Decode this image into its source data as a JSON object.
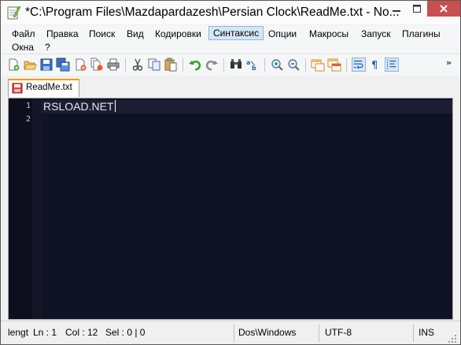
{
  "window": {
    "title": "*C:\\Program Files\\Mazdapardazesh\\Persian Clock\\ReadMe.txt - No..."
  },
  "menu": {
    "items": [
      {
        "label": "Файл"
      },
      {
        "label": "Правка"
      },
      {
        "label": "Поиск"
      },
      {
        "label": "Вид"
      },
      {
        "label": "Кодировки"
      },
      {
        "label": "Синтаксис",
        "active": true
      },
      {
        "label": "Опции"
      },
      {
        "label": "Макросы"
      },
      {
        "label": "Запуск"
      },
      {
        "label": "Плагины"
      },
      {
        "label": "Окна"
      },
      {
        "label": "?"
      }
    ]
  },
  "toolbar": {
    "icons": [
      "new-file-icon",
      "open-file-icon",
      "save-icon",
      "save-all-icon",
      "close-icon",
      "close-all-icon",
      "print-icon",
      "cut-icon",
      "copy-icon",
      "paste-icon",
      "undo-icon",
      "redo-icon",
      "find-icon",
      "replace-icon",
      "zoom-in-icon",
      "zoom-out-icon",
      "sync-vertical-icon",
      "sync-horizontal-icon",
      "word-wrap-icon",
      "show-all-chars-icon",
      "indent-guide-icon"
    ],
    "more_label": "»"
  },
  "tabs": [
    {
      "label": "ReadMe.txt",
      "unsaved": true
    }
  ],
  "editor": {
    "lines": [
      {
        "number": "1",
        "text": "RSLOAD.NET"
      },
      {
        "number": "2",
        "text": ""
      }
    ],
    "colors": {
      "background": "#101225",
      "text": "#e8e8e8"
    }
  },
  "status": {
    "length": "lengt",
    "ln": "Ln : 1",
    "col": "Col : 12",
    "sel": "Sel : 0 | 0",
    "eol": "Dos\\Windows",
    "encoding": "UTF-8",
    "mode": "INS"
  }
}
